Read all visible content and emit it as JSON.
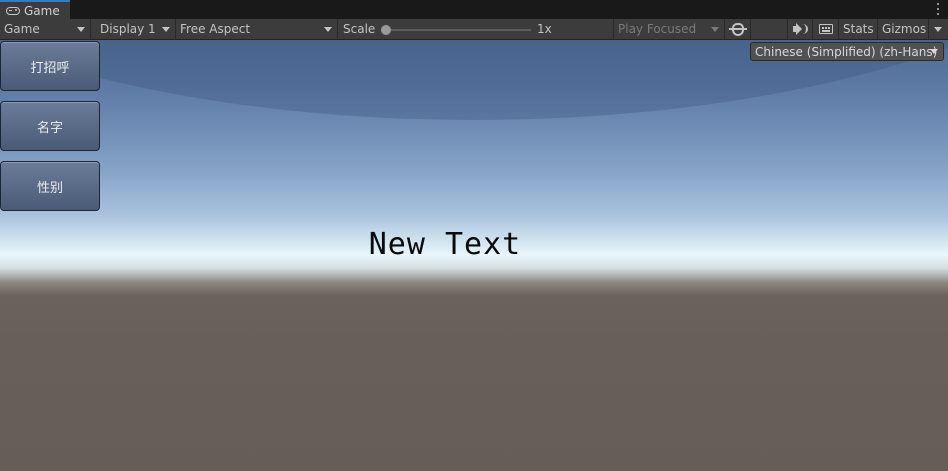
{
  "tab": {
    "title": "Game",
    "icon": "gamepad-icon"
  },
  "toolbar": {
    "view_mode": "Game",
    "display": "Display 1",
    "aspect": "Free Aspect",
    "scale_label": "Scale",
    "scale_value": "1x",
    "play_mode": "Play Focused",
    "stats_label": "Stats",
    "gizmos_label": "Gizmos"
  },
  "viewport": {
    "buttons": [
      "打招呼",
      "名字",
      "性别"
    ],
    "center_text": "New Text",
    "language_dropdown": "Chinese (Simplified) (zh-Hans)"
  },
  "colors": {
    "tab_accent": "#3a79bb",
    "panel_bg": "#3c3c3c",
    "ground": "#675d58",
    "sky_top": "#4f6b95"
  }
}
